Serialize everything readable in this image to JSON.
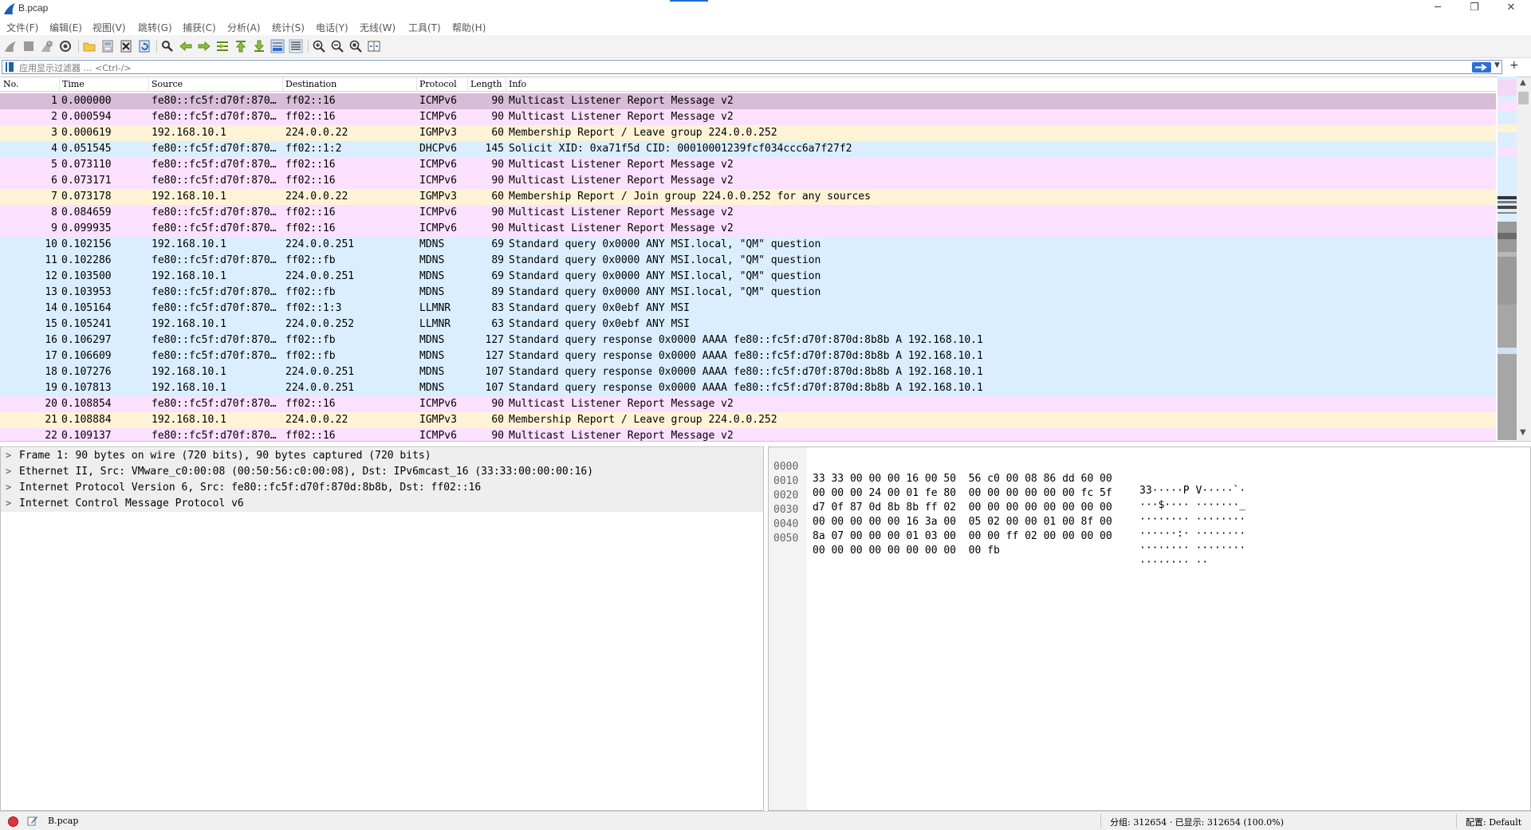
{
  "window": {
    "title": "B.pcap",
    "minimize_icon": "─",
    "maximize_icon": "❐",
    "close_icon": "✕"
  },
  "menu": {
    "items": [
      "文件(F)",
      "编辑(E)",
      "视图(V)",
      "跳转(G)",
      "捕获(C)",
      "分析(A)",
      "统计(S)",
      "电话(Y)",
      "无线(W)",
      "工具(T)",
      "帮助(H)"
    ]
  },
  "filter": {
    "placeholder": "应用显示过滤器 … <Ctrl-/>",
    "dropdown_icon": "▼",
    "plus_label": "+"
  },
  "packet_list": {
    "columns": [
      "No.",
      "Time",
      "Source",
      "Destination",
      "Protocol",
      "Length",
      "Info"
    ],
    "colors": {
      "selected": "#d8bcd8",
      "icmpv6": "#fce0ff",
      "igmp": "#fff3d6",
      "udp": "#daeeff"
    },
    "rows": [
      {
        "no": "1",
        "time": "0.000000",
        "src": "fe80::fc5f:d70f:870…",
        "dst": "ff02::16",
        "proto": "ICMPv6",
        "len": "90",
        "info": "Multicast Listener Report Message v2",
        "kind": "selected"
      },
      {
        "no": "2",
        "time": "0.000594",
        "src": "fe80::fc5f:d70f:870…",
        "dst": "ff02::16",
        "proto": "ICMPv6",
        "len": "90",
        "info": "Multicast Listener Report Message v2",
        "kind": "icmpv6"
      },
      {
        "no": "3",
        "time": "0.000619",
        "src": "192.168.10.1",
        "dst": "224.0.0.22",
        "proto": "IGMPv3",
        "len": "60",
        "info": "Membership Report / Leave group 224.0.0.252",
        "kind": "igmp"
      },
      {
        "no": "4",
        "time": "0.051545",
        "src": "fe80::fc5f:d70f:870…",
        "dst": "ff02::1:2",
        "proto": "DHCPv6",
        "len": "145",
        "info": "Solicit XID: 0xa71f5d CID: 00010001239fcf034ccc6a7f27f2",
        "kind": "udp"
      },
      {
        "no": "5",
        "time": "0.073110",
        "src": "fe80::fc5f:d70f:870…",
        "dst": "ff02::16",
        "proto": "ICMPv6",
        "len": "90",
        "info": "Multicast Listener Report Message v2",
        "kind": "icmpv6"
      },
      {
        "no": "6",
        "time": "0.073171",
        "src": "fe80::fc5f:d70f:870…",
        "dst": "ff02::16",
        "proto": "ICMPv6",
        "len": "90",
        "info": "Multicast Listener Report Message v2",
        "kind": "icmpv6"
      },
      {
        "no": "7",
        "time": "0.073178",
        "src": "192.168.10.1",
        "dst": "224.0.0.22",
        "proto": "IGMPv3",
        "len": "60",
        "info": "Membership Report / Join group 224.0.0.252 for any sources",
        "kind": "igmp"
      },
      {
        "no": "8",
        "time": "0.084659",
        "src": "fe80::fc5f:d70f:870…",
        "dst": "ff02::16",
        "proto": "ICMPv6",
        "len": "90",
        "info": "Multicast Listener Report Message v2",
        "kind": "icmpv6"
      },
      {
        "no": "9",
        "time": "0.099935",
        "src": "fe80::fc5f:d70f:870…",
        "dst": "ff02::16",
        "proto": "ICMPv6",
        "len": "90",
        "info": "Multicast Listener Report Message v2",
        "kind": "icmpv6"
      },
      {
        "no": "10",
        "time": "0.102156",
        "src": "192.168.10.1",
        "dst": "224.0.0.251",
        "proto": "MDNS",
        "len": "69",
        "info": "Standard query 0x0000 ANY MSI.local, \"QM\" question",
        "kind": "udp"
      },
      {
        "no": "11",
        "time": "0.102286",
        "src": "fe80::fc5f:d70f:870…",
        "dst": "ff02::fb",
        "proto": "MDNS",
        "len": "89",
        "info": "Standard query 0x0000 ANY MSI.local, \"QM\" question",
        "kind": "udp"
      },
      {
        "no": "12",
        "time": "0.103500",
        "src": "192.168.10.1",
        "dst": "224.0.0.251",
        "proto": "MDNS",
        "len": "69",
        "info": "Standard query 0x0000 ANY MSI.local, \"QM\" question",
        "kind": "udp"
      },
      {
        "no": "13",
        "time": "0.103953",
        "src": "fe80::fc5f:d70f:870…",
        "dst": "ff02::fb",
        "proto": "MDNS",
        "len": "89",
        "info": "Standard query 0x0000 ANY MSI.local, \"QM\" question",
        "kind": "udp"
      },
      {
        "no": "14",
        "time": "0.105164",
        "src": "fe80::fc5f:d70f:870…",
        "dst": "ff02::1:3",
        "proto": "LLMNR",
        "len": "83",
        "info": "Standard query 0x0ebf ANY MSI",
        "kind": "udp"
      },
      {
        "no": "15",
        "time": "0.105241",
        "src": "192.168.10.1",
        "dst": "224.0.0.252",
        "proto": "LLMNR",
        "len": "63",
        "info": "Standard query 0x0ebf ANY MSI",
        "kind": "udp"
      },
      {
        "no": "16",
        "time": "0.106297",
        "src": "fe80::fc5f:d70f:870…",
        "dst": "ff02::fb",
        "proto": "MDNS",
        "len": "127",
        "info": "Standard query response 0x0000 AAAA fe80::fc5f:d70f:870d:8b8b A 192.168.10.1",
        "kind": "udp"
      },
      {
        "no": "17",
        "time": "0.106609",
        "src": "fe80::fc5f:d70f:870…",
        "dst": "ff02::fb",
        "proto": "MDNS",
        "len": "127",
        "info": "Standard query response 0x0000 AAAA fe80::fc5f:d70f:870d:8b8b A 192.168.10.1",
        "kind": "udp"
      },
      {
        "no": "18",
        "time": "0.107276",
        "src": "192.168.10.1",
        "dst": "224.0.0.251",
        "proto": "MDNS",
        "len": "107",
        "info": "Standard query response 0x0000 AAAA fe80::fc5f:d70f:870d:8b8b A 192.168.10.1",
        "kind": "udp"
      },
      {
        "no": "19",
        "time": "0.107813",
        "src": "192.168.10.1",
        "dst": "224.0.0.251",
        "proto": "MDNS",
        "len": "107",
        "info": "Standard query response 0x0000 AAAA fe80::fc5f:d70f:870d:8b8b A 192.168.10.1",
        "kind": "udp"
      },
      {
        "no": "20",
        "time": "0.108854",
        "src": "fe80::fc5f:d70f:870…",
        "dst": "ff02::16",
        "proto": "ICMPv6",
        "len": "90",
        "info": "Multicast Listener Report Message v2",
        "kind": "icmpv6"
      },
      {
        "no": "21",
        "time": "0.108884",
        "src": "192.168.10.1",
        "dst": "224.0.0.22",
        "proto": "IGMPv3",
        "len": "60",
        "info": "Membership Report / Leave group 224.0.0.252",
        "kind": "igmp"
      },
      {
        "no": "22",
        "time": "0.109137",
        "src": "fe80::fc5f:d70f:870…",
        "dst": "ff02::16",
        "proto": "ICMPv6",
        "len": "90",
        "info": "Multicast Listener Report Message v2",
        "kind": "icmpv6"
      }
    ]
  },
  "details": {
    "chevron": ">",
    "lines": [
      "Frame 1: 90 bytes on wire (720 bits), 90 bytes captured (720 bits)",
      "Ethernet II, Src: VMware_c0:00:08 (00:50:56:c0:00:08), Dst: IPv6mcast_16 (33:33:00:00:00:16)",
      "Internet Protocol Version 6, Src: fe80::fc5f:d70f:870d:8b8b, Dst: ff02::16",
      "Internet Control Message Protocol v6"
    ]
  },
  "bytes": {
    "lines": [
      {
        "offset": "0000",
        "hex": "33 33 00 00 00 16 00 50  56 c0 00 08 86 dd 60 00",
        "ascii": "33·····P V·····`·"
      },
      {
        "offset": "0010",
        "hex": "00 00 00 24 00 01 fe 80  00 00 00 00 00 00 fc 5f",
        "ascii": "···$···· ·······_"
      },
      {
        "offset": "0020",
        "hex": "d7 0f 87 0d 8b 8b ff 02  00 00 00 00 00 00 00 00",
        "ascii": "········ ········"
      },
      {
        "offset": "0030",
        "hex": "00 00 00 00 00 16 3a 00  05 02 00 00 01 00 8f 00",
        "ascii": "······:· ········"
      },
      {
        "offset": "0040",
        "hex": "8a 07 00 00 00 01 03 00  00 00 ff 02 00 00 00 00",
        "ascii": "········ ········"
      },
      {
        "offset": "0050",
        "hex": "00 00 00 00 00 00 00 00  00 fb",
        "ascii": "········ ··"
      }
    ]
  },
  "status": {
    "file": "B.pcap",
    "packets": "分组: 312654 · 已显示: 312654 (100.0%)",
    "profile": "配置: Default"
  }
}
